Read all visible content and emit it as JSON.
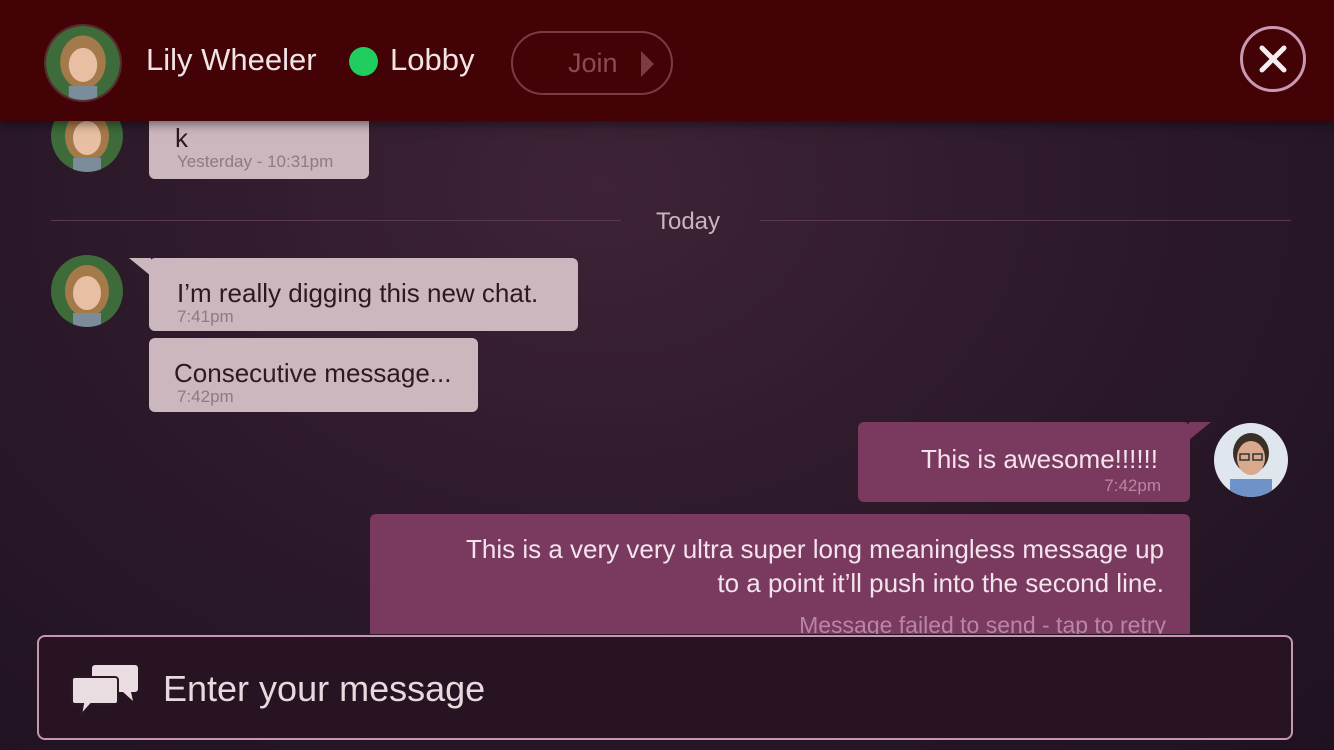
{
  "header": {
    "contact_name": "Lily Wheeler",
    "room": "Lobby",
    "status_color": "#1fce5e",
    "join_label": "Join",
    "close_icon": "close-icon"
  },
  "divider": {
    "label": "Today"
  },
  "messages": [
    {
      "text": "k",
      "time": "Yesterday - 10:31pm",
      "direction": "incoming"
    },
    {
      "text": "I’m really digging this new chat.",
      "time": "7:41pm",
      "direction": "incoming"
    },
    {
      "text": "Consecutive message...",
      "time": "7:42pm",
      "direction": "incoming"
    },
    {
      "text": "This is awesome!!!!!!",
      "time": "7:42pm",
      "direction": "outgoing"
    },
    {
      "line1": "This is a very very ultra super long meaningless message up",
      "line2": "to a point it’ll push into the second line.",
      "status": "Message failed to send - tap to retry",
      "direction": "outgoing"
    }
  ],
  "composer": {
    "placeholder": "Enter your message",
    "icon": "chat-bubbles-icon"
  },
  "colors": {
    "header_bg": "#430206",
    "incoming_bubble": "#cdb7bf",
    "outgoing_bubble": "#7a3a60",
    "accent_border": "#c797b2"
  }
}
